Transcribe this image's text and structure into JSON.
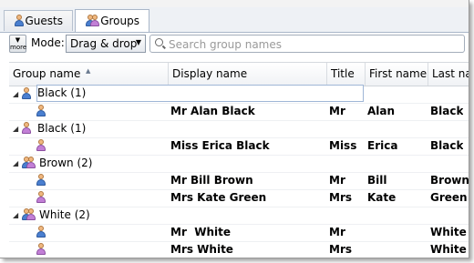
{
  "tabs": [
    {
      "label": "Guests",
      "icon": "person-icon"
    },
    {
      "label": "Groups",
      "icon": "group-icon",
      "active": true
    }
  ],
  "toolbar": {
    "more_arrow": "▼",
    "more_label": "more",
    "mode_label": "Mode:",
    "mode_value": "Drag & drop",
    "search_placeholder": "Search group names"
  },
  "columns": [
    "Group name",
    "Display name",
    "Title",
    "First name",
    "Last name"
  ],
  "groups": [
    {
      "name": "Black (1)",
      "members": [
        {
          "display": "Mr Alan Black",
          "title": "Mr",
          "first": "Alan",
          "last": "Black"
        }
      ]
    },
    {
      "name": "Black (1)",
      "members": [
        {
          "display": "Miss Erica Black",
          "title": "Miss",
          "first": "Erica",
          "last": "Black"
        }
      ]
    },
    {
      "name": "Brown (2)",
      "members": [
        {
          "display": "Mr Bill Brown",
          "title": "Mr",
          "first": "Bill",
          "last": "Brown"
        },
        {
          "display": "Mrs Kate Green",
          "title": "Mrs",
          "first": "Kate",
          "last": "Green"
        }
      ]
    },
    {
      "name": "White (2)",
      "members": [
        {
          "display": "Mr  White",
          "title": "Mr",
          "first": "",
          "last": "White"
        },
        {
          "display": "Mrs White",
          "title": "Mrs",
          "first": "",
          "last": "White"
        }
      ]
    }
  ]
}
